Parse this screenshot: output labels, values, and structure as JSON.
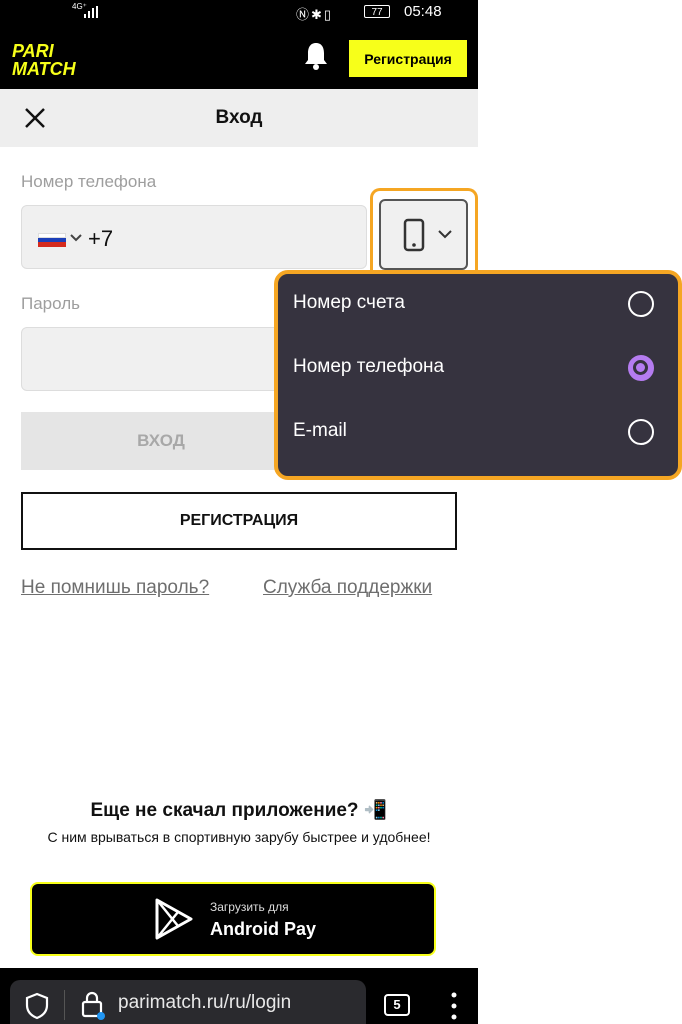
{
  "status_bar": {
    "network": "4G⁺",
    "battery": "77",
    "time": "05:48"
  },
  "header": {
    "logo_line1": "PARI",
    "logo_line2": "MATCH",
    "register_label": "Регистрация"
  },
  "titlebar": {
    "title": "Вход"
  },
  "form": {
    "phone_label": "Номер телефона",
    "phone_prefix": "+7",
    "password_label": "Пароль",
    "login_button": "ВХОД",
    "register_button": "РЕГИСТРАЦИЯ",
    "forgot_link": "Не помнишь пароль?",
    "support_link": "Служба поддержки"
  },
  "login_type_dropdown": {
    "options": [
      {
        "label": "Номер счета",
        "selected": false
      },
      {
        "label": "Номер телефона",
        "selected": true
      },
      {
        "label": "E-mail",
        "selected": false
      }
    ]
  },
  "promo": {
    "title": "Еще не скачал приложение? 📲",
    "text": "С ним врываться в спортивную зарубу быстрее и удобнее!",
    "button_small": "Загрузить для",
    "button_big": "Android Pay"
  },
  "browser": {
    "url": "parimatch.ru/ru/login",
    "tab_count": "5"
  },
  "colors": {
    "brand_yellow": "#f7ff1a",
    "highlight_orange": "#f5a623",
    "dropdown_bg": "#36333f",
    "radio_selected": "#b57cf0"
  }
}
